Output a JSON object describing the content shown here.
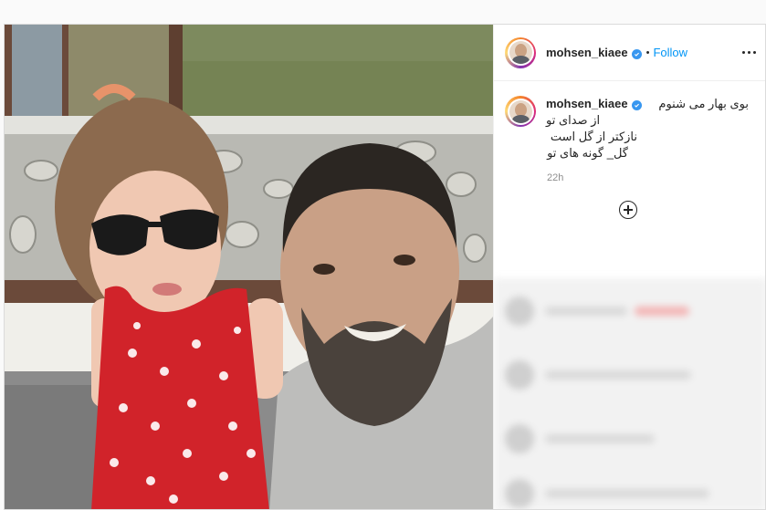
{
  "photo": {
    "description_alt": ""
  },
  "header": {
    "username": "mohsen_kiaee",
    "verified": true,
    "separator": "•",
    "follow_label": "Follow"
  },
  "caption": {
    "username": "mohsen_kiaee",
    "line1": "بوی بهار می شنوم",
    "line2": "از صدای تو",
    "line3": "نازکتر از گل است",
    "line4": "گل_ گونه های تو",
    "time": "22h"
  },
  "colors": {
    "accent": "#0095f6",
    "verified": "#3897f0",
    "border": "#dbdbdb"
  },
  "icons": {
    "more": "more-options-icon",
    "load_more": "add-circle-icon"
  }
}
